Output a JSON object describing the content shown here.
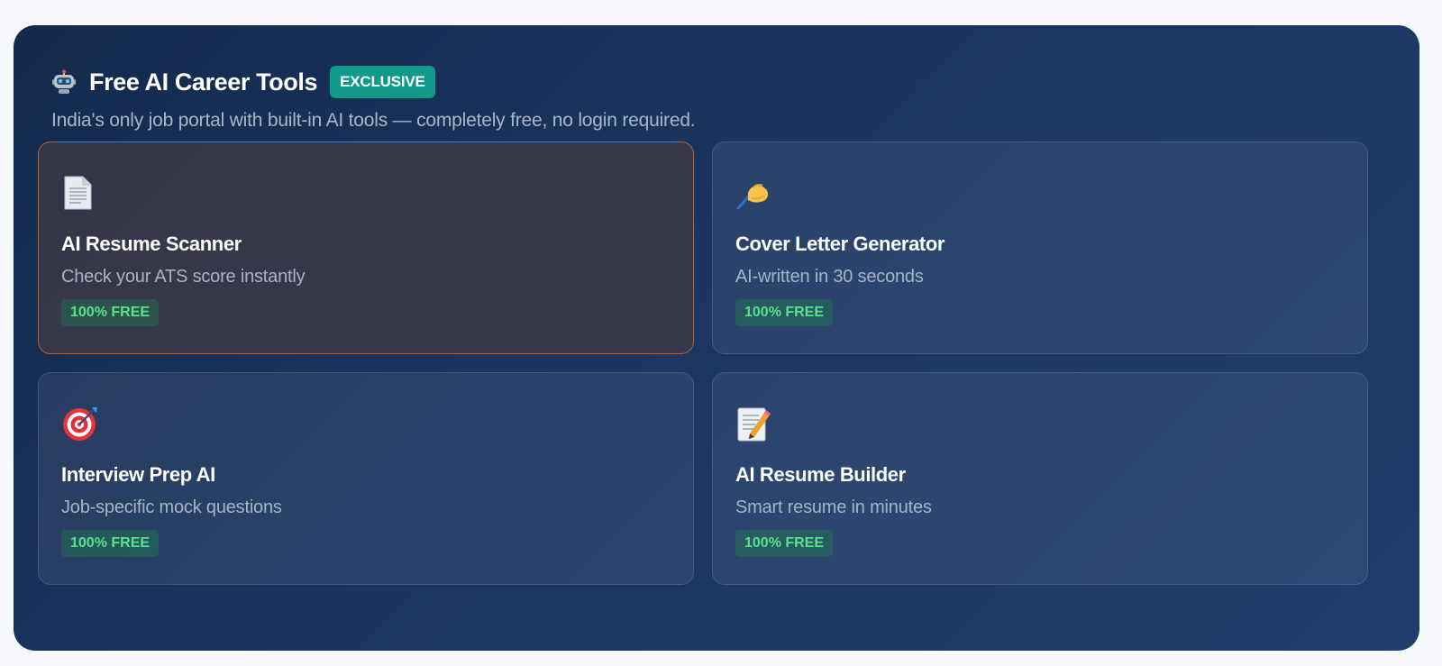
{
  "header": {
    "title": "Free AI Career Tools",
    "badge": "EXCLUSIVE",
    "subtitle": "India's only job portal with built-in AI tools — completely free, no login required.",
    "icon": "robot-icon"
  },
  "cards": [
    {
      "title": "AI Resume Scanner",
      "description": "Check your ATS score instantly",
      "badge": "100% FREE",
      "icon": "document-icon",
      "active": true
    },
    {
      "title": "Cover Letter Generator",
      "description": "AI-written in 30 seconds",
      "badge": "100% FREE",
      "icon": "writing-hand-icon",
      "active": false
    },
    {
      "title": "Interview Prep AI",
      "description": "Job-specific mock questions",
      "badge": "100% FREE",
      "icon": "target-icon",
      "active": false
    },
    {
      "title": "AI Resume Builder",
      "description": "Smart resume in minutes",
      "badge": "100% FREE",
      "icon": "memo-icon",
      "active": false
    }
  ],
  "colors": {
    "panel_bg": "#1b3560",
    "exclusive_badge": "#11998a",
    "free_badge_text": "#5be08f",
    "active_border": "#b0633a"
  }
}
